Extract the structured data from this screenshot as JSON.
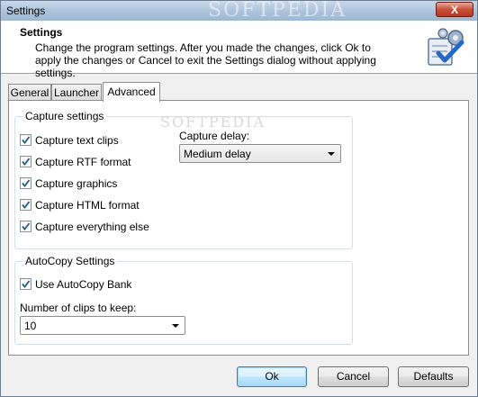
{
  "window": {
    "title": "Settings",
    "close_label": "X",
    "watermark": "SOFTPEDIA"
  },
  "header": {
    "title": "Settings",
    "description": "Change the program settings. After you made the changes, click Ok to apply the changes or Cancel to exit the Settings dialog without applying settings.",
    "icon": "settings-checklist-gears-icon"
  },
  "tabs": [
    {
      "label": "General"
    },
    {
      "label": "Launcher"
    },
    {
      "label": "Advanced",
      "active": true
    }
  ],
  "capture": {
    "legend": "Capture settings",
    "options": [
      {
        "label": "Capture text clips",
        "checked": true
      },
      {
        "label": "Capture RTF format",
        "checked": true
      },
      {
        "label": "Capture graphics",
        "checked": true
      },
      {
        "label": "Capture HTML format",
        "checked": true
      },
      {
        "label": "Capture everything else",
        "checked": true
      }
    ],
    "delay_label": "Capture delay:",
    "delay_value": "Medium delay"
  },
  "autocopy": {
    "legend": "AutoCopy Settings",
    "use_bank_label": "Use AutoCopy Bank",
    "use_bank_checked": true,
    "clips_label": "Number of clips to keep:",
    "clips_value": "10"
  },
  "buttons": {
    "ok": "Ok",
    "cancel": "Cancel",
    "defaults": "Defaults"
  },
  "colors": {
    "accent": "#3c7fb1",
    "close": "#c7503a",
    "check": "#2a5a8c"
  }
}
